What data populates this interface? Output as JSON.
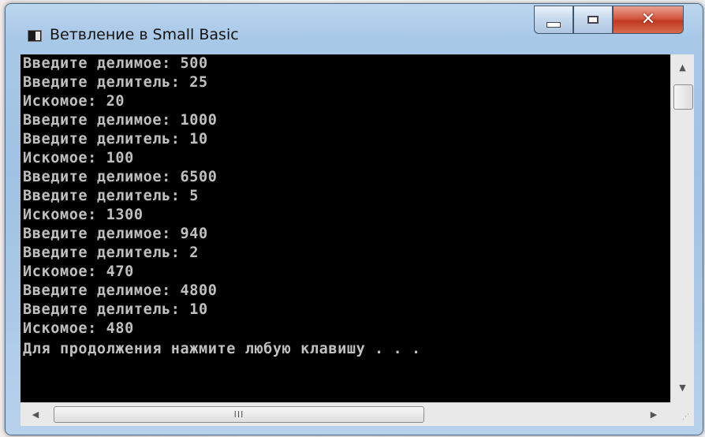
{
  "window": {
    "title": "Ветвление в Small Basic",
    "icon": "console-window-icon",
    "controls": {
      "minimize": "minimize-icon",
      "maximize": "maximize-icon",
      "close": "✕"
    }
  },
  "console": {
    "lines": [
      "Введите делимое: 500",
      "Введите делитель: 25",
      "Искомое: 20",
      "Введите делимое: 1000",
      "Введите делитель: 10",
      "Искомое: 100",
      "Введите делимое: 6500",
      "Введите делитель: 5",
      "Искомое: 1300",
      "Введите делимое: 940",
      "Введите делитель: 2",
      "Искомое: 470",
      "Введите делимое: 4800",
      "Введите делитель: 10",
      "Искомое: 480",
      "Для продолжения нажмите любую клавишу . . ."
    ],
    "text_color": "#c0c0c0",
    "background": "#000000"
  },
  "scrollbars": {
    "up": "▲",
    "down": "▼",
    "left": "◀",
    "right": "▶",
    "grip": "III",
    "resize": "⋰"
  }
}
